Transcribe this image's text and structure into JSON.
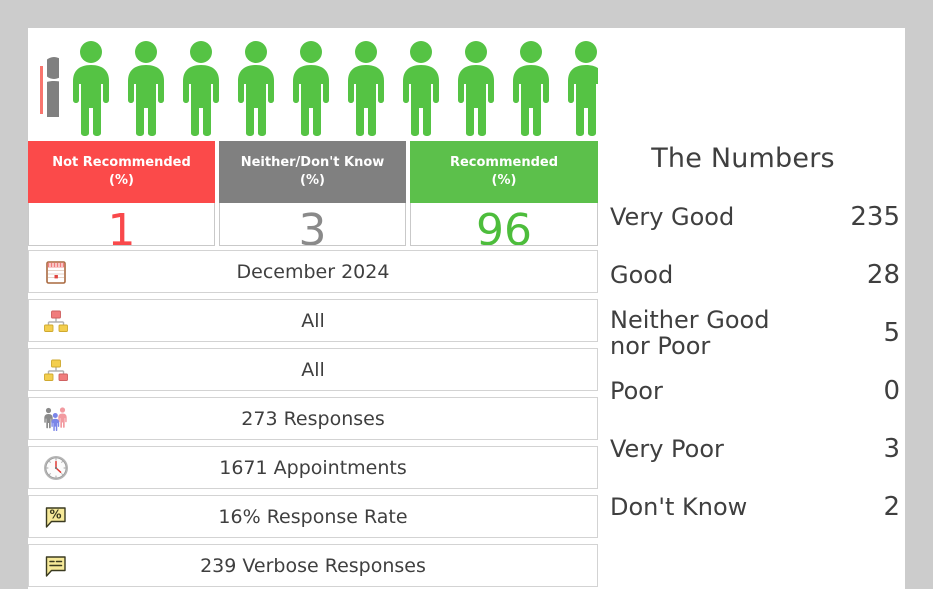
{
  "pictogram": {
    "full_green_people": 10,
    "partial_grey_person": true,
    "partial_red_sliver": true,
    "green_color": "#55c344",
    "grey_color": "#808080",
    "red_color": "#f9756e"
  },
  "headline": {
    "columns": [
      {
        "title_line1": "Not Recommended",
        "title_line2": "(%)",
        "value": "1",
        "header_color": "#fb4a4a",
        "value_color": "#f9494b"
      },
      {
        "title_line1": "Neither/Don't Know",
        "title_line2": "(%)",
        "value": "3",
        "header_color": "#808080",
        "value_color": "#8a8a8a"
      },
      {
        "title_line1": "Recommended",
        "title_line2": "(%)",
        "value": "96",
        "header_color": "#5cc04b",
        "value_color": "#4dbd3c"
      }
    ]
  },
  "rows": [
    {
      "icon": "calendar-icon",
      "label": "December 2024"
    },
    {
      "icon": "org-chart-red-parent-icon",
      "label": "All"
    },
    {
      "icon": "org-chart-yellow-parent-icon",
      "label": "All"
    },
    {
      "icon": "people-group-icon",
      "label": "273 Responses"
    },
    {
      "icon": "clock-icon",
      "label": "1671 Appointments"
    },
    {
      "icon": "percent-bubble-icon",
      "label": "16% Response Rate"
    },
    {
      "icon": "comment-bubble-icon",
      "label": "239 Verbose Responses"
    }
  ],
  "numbers_panel": {
    "title": "The Numbers",
    "items": [
      {
        "label": "Very Good",
        "value": "235"
      },
      {
        "label": "Good",
        "value": "28"
      },
      {
        "label": "Neither Good nor Poor",
        "value": "5"
      },
      {
        "label": "Poor",
        "value": "0"
      },
      {
        "label": "Very Poor",
        "value": "3"
      },
      {
        "label": "Don't Know",
        "value": "2"
      }
    ]
  }
}
